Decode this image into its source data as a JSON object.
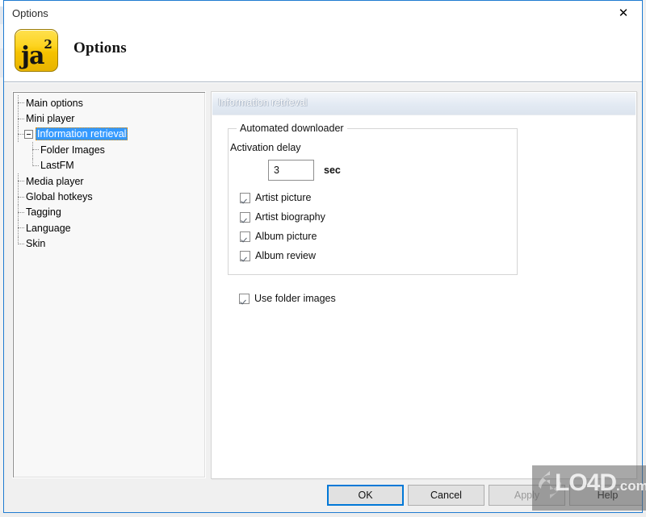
{
  "window": {
    "title": "Options",
    "close_icon": "close-x-icon"
  },
  "header": {
    "logo_text": "ja",
    "logo_sup": "2",
    "logo_icon": "jaangle-app-icon",
    "title": "Options"
  },
  "tree": {
    "items": [
      {
        "label": "Main options",
        "level": 0,
        "expander": false,
        "selected": false
      },
      {
        "label": "Mini player",
        "level": 0,
        "expander": false,
        "selected": false
      },
      {
        "label": "Information retrieval",
        "level": 0,
        "expander": true,
        "selected": true
      },
      {
        "label": "Folder Images",
        "level": 1,
        "expander": false,
        "selected": false
      },
      {
        "label": "LastFM",
        "level": 1,
        "expander": false,
        "selected": false
      },
      {
        "label": "Media player",
        "level": 0,
        "expander": false,
        "selected": false
      },
      {
        "label": "Global hotkeys",
        "level": 0,
        "expander": false,
        "selected": false
      },
      {
        "label": "Tagging",
        "level": 0,
        "expander": false,
        "selected": false
      },
      {
        "label": "Language",
        "level": 0,
        "expander": false,
        "selected": false
      },
      {
        "label": "Skin",
        "level": 0,
        "expander": false,
        "selected": false
      }
    ]
  },
  "content": {
    "header_title": "Information retrieval",
    "groupbox": {
      "title": "Automated downloader",
      "delay_label": "Activation delay",
      "delay_value": "3",
      "delay_unit": "sec",
      "checkboxes": [
        {
          "label": "Artist picture",
          "checked": true
        },
        {
          "label": "Artist biography",
          "checked": true
        },
        {
          "label": "Album picture",
          "checked": true
        },
        {
          "label": "Album review",
          "checked": true
        }
      ]
    },
    "folder_images": {
      "label": "Use folder images",
      "checked": true
    }
  },
  "buttons": {
    "ok": "OK",
    "cancel": "Cancel",
    "apply": "Apply",
    "help": "Help"
  },
  "watermark": {
    "brand": "LO4D",
    "domain": ".com"
  },
  "colors": {
    "accent": "#0078d7",
    "selection": "#3399ff",
    "window_border": "#1f7bd1",
    "logo_gold": "#fdd421",
    "dialog_bg": "#f0f0f0"
  }
}
